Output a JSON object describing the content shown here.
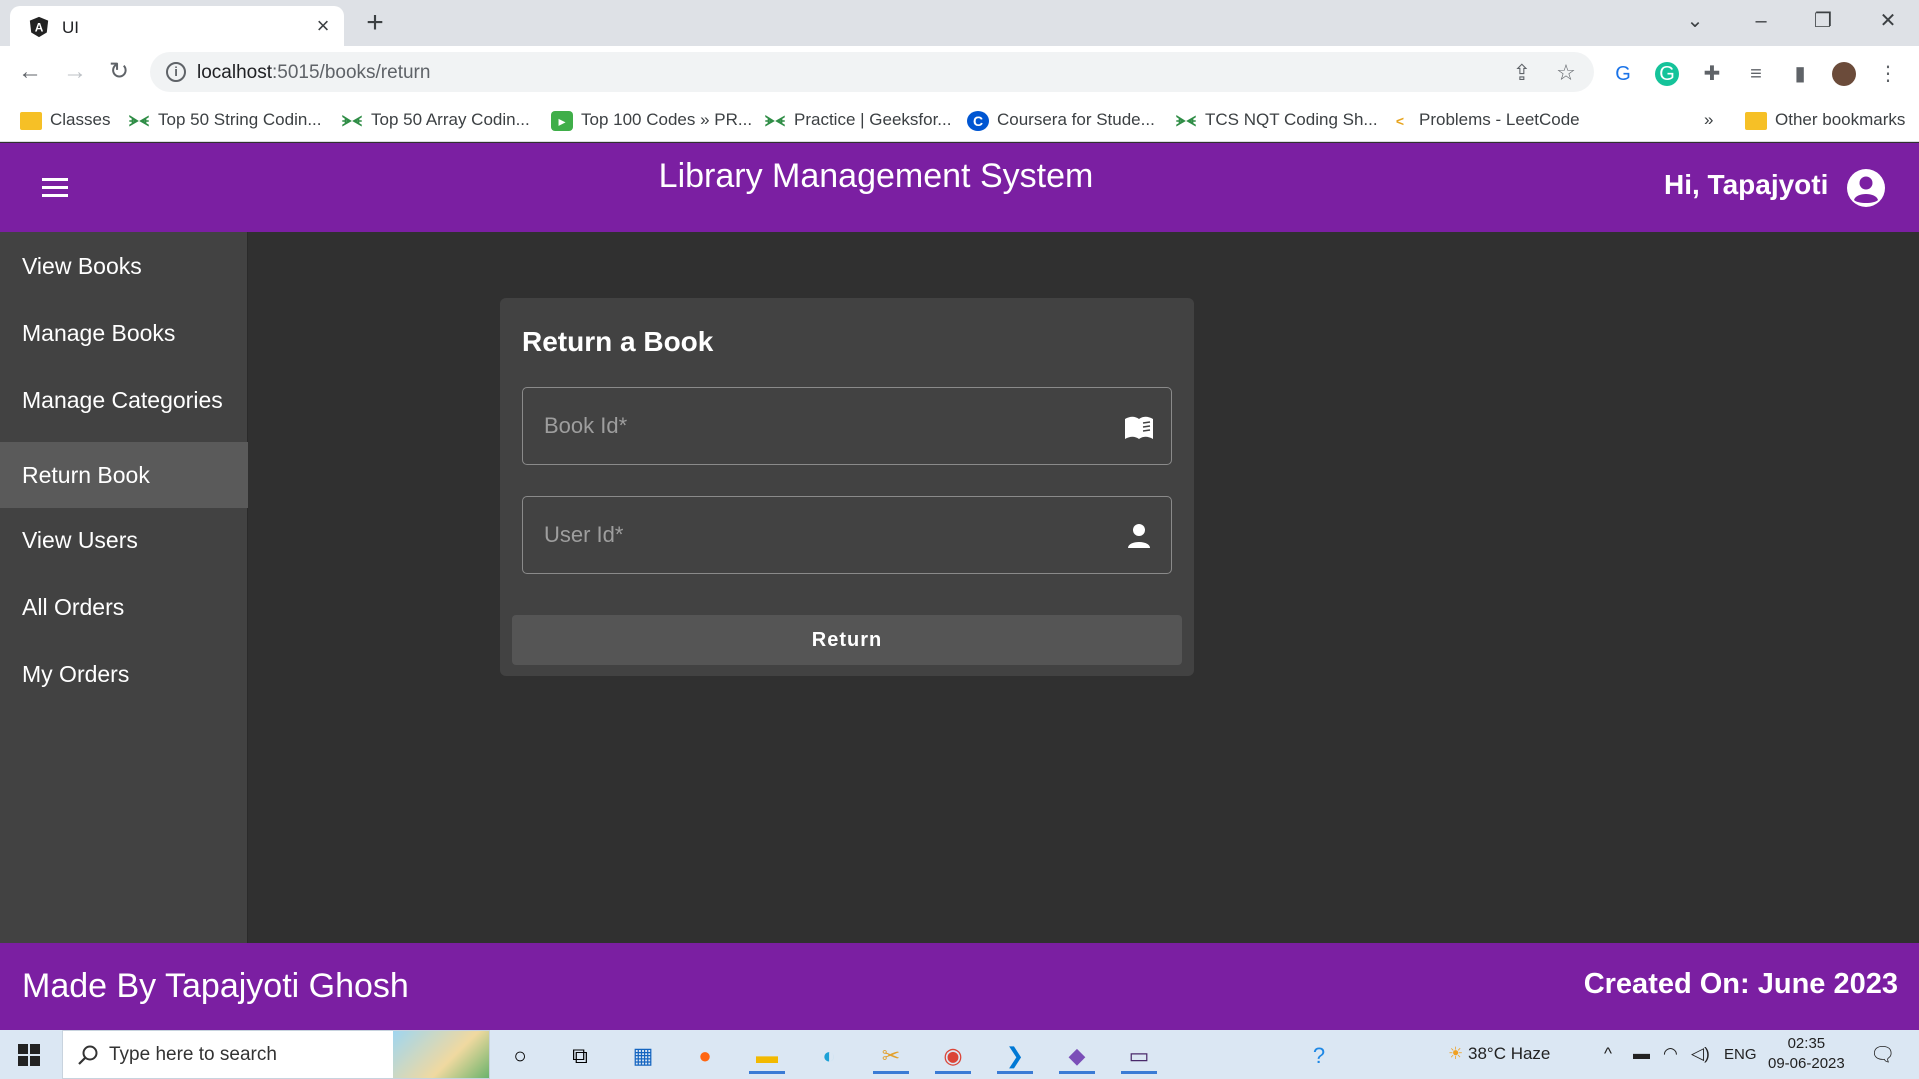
{
  "browser": {
    "tab_title": "UI",
    "url_host": "localhost",
    "url_rest": ":5015/books/return",
    "bookmarks": [
      {
        "label": "Classes",
        "icon": "folder-icon"
      },
      {
        "label": "Top 50 String Codin...",
        "icon": "gfg-icon"
      },
      {
        "label": "Top 50 Array Codin...",
        "icon": "gfg-icon"
      },
      {
        "label": "Top 100 Codes » PR...",
        "icon": "shield-icon"
      },
      {
        "label": "Practice | Geeksfor...",
        "icon": "gfg-icon"
      },
      {
        "label": "Coursera for Stude...",
        "icon": "coursera-icon"
      },
      {
        "label": "TCS NQT Coding Sh...",
        "icon": "gfg-icon"
      },
      {
        "label": "Problems - LeetCode",
        "icon": "leetcode-icon"
      }
    ],
    "bookmarks_overflow": "»",
    "other_bookmarks": "Other bookmarks"
  },
  "app": {
    "title": "Library Management System",
    "greeting": "Hi, Tapajyoti",
    "nav": [
      {
        "label": "View Books",
        "active": false
      },
      {
        "label": "Manage Books",
        "active": false
      },
      {
        "label": "Manage Categories",
        "active": false
      },
      {
        "label": "Return Book",
        "active": true
      },
      {
        "label": "View Users",
        "active": false
      },
      {
        "label": "All Orders",
        "active": false
      },
      {
        "label": "My Orders",
        "active": false
      }
    ],
    "form": {
      "title": "Return a Book",
      "book_id_placeholder": "Book Id*",
      "user_id_placeholder": "User Id*",
      "submit_label": "Return"
    },
    "footer_left": "Made By Tapajyoti Ghosh",
    "footer_right": "Created On: June 2023",
    "colors": {
      "primary": "#7b1fa2",
      "background": "#303030",
      "card": "#424242",
      "sidenav": "#424242"
    }
  },
  "taskbar": {
    "search_placeholder": "Type here to search",
    "weather": "38°C  Haze",
    "language": "ENG",
    "time": "02:35",
    "date": "09-06-2023"
  }
}
